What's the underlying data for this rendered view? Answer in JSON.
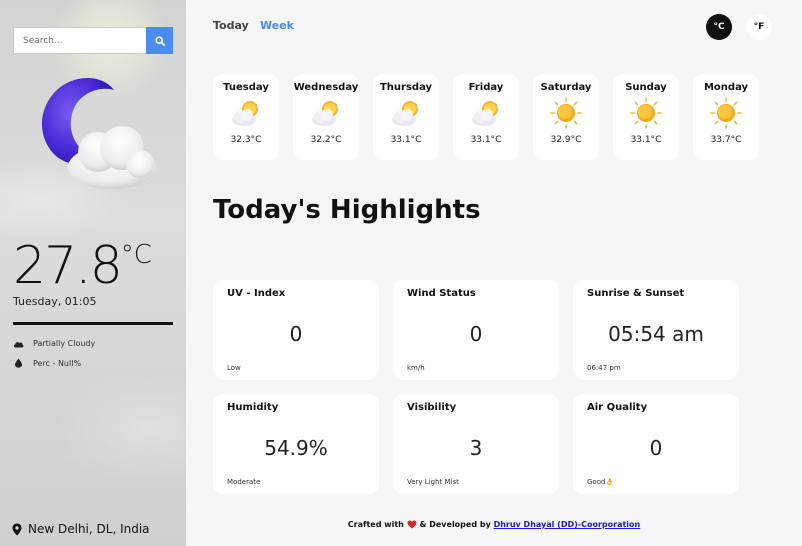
{
  "search": {
    "placeholder": "Search..."
  },
  "current": {
    "temperature": "27.8",
    "unit": "°C",
    "datetime": "Tuesday, 01:05",
    "condition": "Partially Cloudy",
    "precipitation": "Perc - Null%",
    "location": "New Delhi, DL, India"
  },
  "tabs": {
    "today": "Today",
    "week": "Week"
  },
  "units": {
    "celsius": "°C",
    "fahrenheit": "°F"
  },
  "forecast": [
    {
      "day": "Tuesday",
      "temp": "32.3°C",
      "icon": "partly-sunny-icon"
    },
    {
      "day": "Wednesday",
      "temp": "32.2°C",
      "icon": "partly-sunny-icon"
    },
    {
      "day": "Thursday",
      "temp": "33.1°C",
      "icon": "partly-sunny-icon"
    },
    {
      "day": "Friday",
      "temp": "33.1°C",
      "icon": "partly-sunny-icon"
    },
    {
      "day": "Saturday",
      "temp": "32.9°C",
      "icon": "sun-icon"
    },
    {
      "day": "Sunday",
      "temp": "33.1°C",
      "icon": "sun-icon"
    },
    {
      "day": "Monday",
      "temp": "33.7°C",
      "icon": "sun-icon"
    }
  ],
  "highlights": {
    "title": "Today's Highlights",
    "uv": {
      "title": "UV - Index",
      "value": "0",
      "sub": "Low"
    },
    "wind": {
      "title": "Wind Status",
      "value": "0",
      "sub": "km/h"
    },
    "sun": {
      "title": "Sunrise & Sunset",
      "value": "05:54 am",
      "sub": "06:47 pm"
    },
    "humidity": {
      "title": "Humidity",
      "value": "54.9%",
      "sub": "Moderate"
    },
    "visibility": {
      "title": "Visibility",
      "value": "3",
      "sub": "Very Light Mist"
    },
    "air": {
      "title": "Air Quality",
      "value": "0",
      "sub": "Good👌"
    }
  },
  "footer": {
    "crafted": "Crafted with",
    "developed": "& Developed by",
    "author": "Dhruv Dhayal (DD)-Coorporation"
  },
  "colors": {
    "accent": "#4a8cf0",
    "dark": "#111111",
    "heart": "#d62828"
  }
}
